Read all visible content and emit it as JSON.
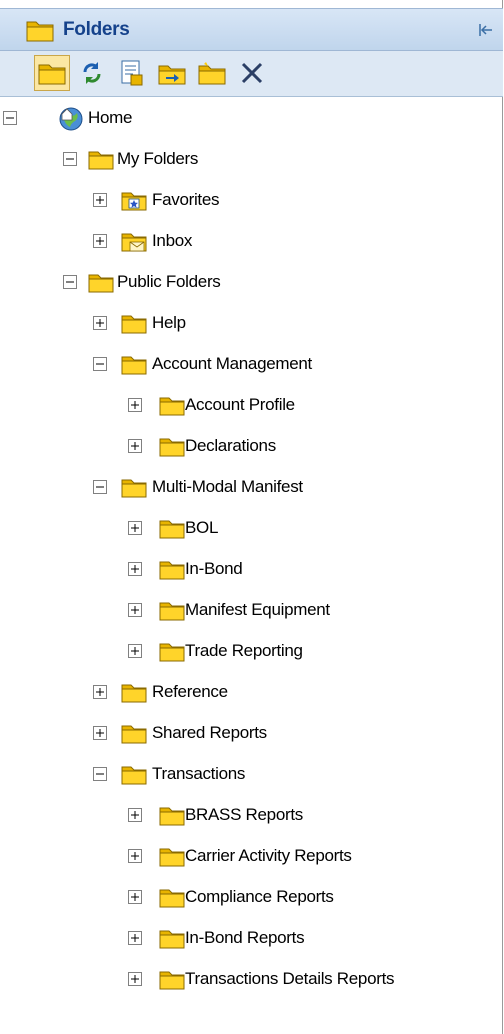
{
  "panel": {
    "title": "Folders",
    "title_color": "#15428b",
    "header_bg": "#c7d9ee",
    "collapse_icon": "collapse-left-icon"
  },
  "toolbar": {
    "buttons": [
      {
        "icon": "folder-icon",
        "active": true
      },
      {
        "icon": "refresh-icon",
        "active": false
      },
      {
        "icon": "properties-icon",
        "active": false
      },
      {
        "icon": "move-folder-icon",
        "active": false
      },
      {
        "icon": "new-folder-icon",
        "active": false
      },
      {
        "icon": "delete-icon",
        "active": false
      }
    ]
  },
  "tree": [
    {
      "label": "Home",
      "level": 0,
      "expanded": true,
      "icon": "home-icon"
    },
    {
      "label": "My Folders",
      "level": 1,
      "expanded": true,
      "icon": "folder-icon"
    },
    {
      "label": "Favorites",
      "level": 2,
      "expanded": false,
      "icon": "favorites-folder-icon"
    },
    {
      "label": "Inbox",
      "level": 2,
      "expanded": false,
      "icon": "inbox-icon"
    },
    {
      "label": "Public Folders",
      "level": 1,
      "expanded": true,
      "icon": "folder-icon"
    },
    {
      "label": "Help",
      "level": 2,
      "expanded": false,
      "icon": "folder-icon"
    },
    {
      "label": "Account Management",
      "level": 2,
      "expanded": true,
      "icon": "folder-icon"
    },
    {
      "label": "Account Profile",
      "level": 3,
      "expanded": false,
      "icon": "folder-icon"
    },
    {
      "label": "Declarations",
      "level": 3,
      "expanded": false,
      "icon": "folder-icon"
    },
    {
      "label": "Multi-Modal Manifest",
      "level": 2,
      "expanded": true,
      "icon": "folder-icon"
    },
    {
      "label": "BOL",
      "level": 3,
      "expanded": false,
      "icon": "folder-icon"
    },
    {
      "label": "In-Bond",
      "level": 3,
      "expanded": false,
      "icon": "folder-icon"
    },
    {
      "label": "Manifest Equipment",
      "level": 3,
      "expanded": false,
      "icon": "folder-icon"
    },
    {
      "label": "Trade Reporting",
      "level": 3,
      "expanded": false,
      "icon": "folder-icon"
    },
    {
      "label": "Reference",
      "level": 2,
      "expanded": false,
      "icon": "folder-icon"
    },
    {
      "label": "Shared Reports",
      "level": 2,
      "expanded": false,
      "icon": "folder-icon"
    },
    {
      "label": "Transactions",
      "level": 2,
      "expanded": true,
      "icon": "folder-icon"
    },
    {
      "label": "BRASS Reports",
      "level": 3,
      "expanded": false,
      "icon": "folder-icon"
    },
    {
      "label": "Carrier Activity Reports",
      "level": 3,
      "expanded": false,
      "icon": "folder-icon"
    },
    {
      "label": "Compliance Reports",
      "level": 3,
      "expanded": false,
      "icon": "folder-icon"
    },
    {
      "label": "In-Bond Reports",
      "level": 3,
      "expanded": false,
      "icon": "folder-icon"
    },
    {
      "label": "Transactions Details Reports",
      "level": 3,
      "expanded": false,
      "icon": "folder-icon"
    }
  ]
}
